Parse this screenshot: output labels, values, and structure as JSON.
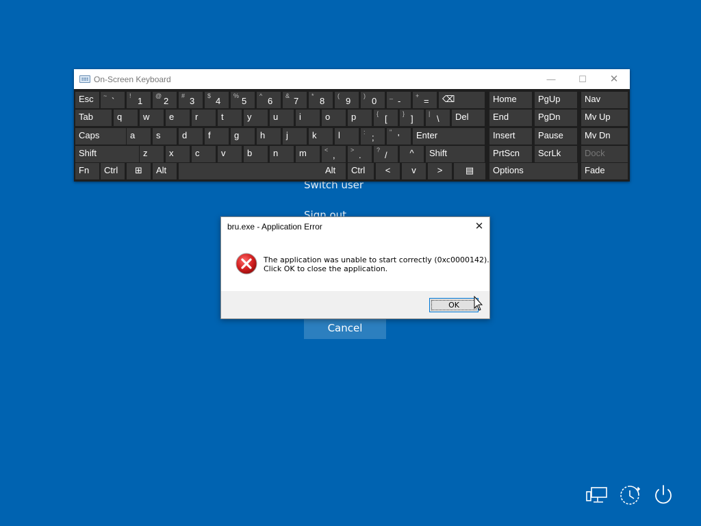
{
  "background": {
    "color": "#0063b1",
    "switch_user": "Switch user",
    "sign_out": "Sign out",
    "cancel": "Cancel"
  },
  "osk": {
    "title": "On-Screen Keyboard",
    "minimize": "—",
    "maximize": "☐",
    "close": "✕",
    "rows": [
      [
        {
          "label": "Esc"
        },
        {
          "shift": "~",
          "main": "`"
        },
        {
          "shift": "!",
          "main": "1"
        },
        {
          "shift": "@",
          "main": "2"
        },
        {
          "shift": "#",
          "main": "3"
        },
        {
          "shift": "$",
          "main": "4"
        },
        {
          "shift": "%",
          "main": "5"
        },
        {
          "shift": "^",
          "main": "6"
        },
        {
          "shift": "&",
          "main": "7"
        },
        {
          "shift": "*",
          "main": "8"
        },
        {
          "shift": "(",
          "main": "9"
        },
        {
          "shift": ")",
          "main": "0"
        },
        {
          "shift": "_",
          "main": "-"
        },
        {
          "shift": "+",
          "main": "="
        },
        {
          "label": "⌫",
          "icon": "backspace-icon"
        },
        {
          "label": "Home"
        },
        {
          "label": "PgUp"
        },
        {
          "label": "Nav"
        }
      ],
      [
        {
          "label": "Tab"
        },
        {
          "label": "q"
        },
        {
          "label": "w"
        },
        {
          "label": "e"
        },
        {
          "label": "r"
        },
        {
          "label": "t"
        },
        {
          "label": "y"
        },
        {
          "label": "u"
        },
        {
          "label": "i"
        },
        {
          "label": "o"
        },
        {
          "label": "p"
        },
        {
          "shift": "{",
          "main": "["
        },
        {
          "shift": "}",
          "main": "]"
        },
        {
          "shift": "|",
          "main": "\\"
        },
        {
          "label": "Del"
        },
        {
          "label": "End"
        },
        {
          "label": "PgDn"
        },
        {
          "label": "Mv Up"
        }
      ],
      [
        {
          "label": "Caps"
        },
        {
          "label": "a"
        },
        {
          "label": "s"
        },
        {
          "label": "d"
        },
        {
          "label": "f"
        },
        {
          "label": "g"
        },
        {
          "label": "h"
        },
        {
          "label": "j"
        },
        {
          "label": "k"
        },
        {
          "label": "l"
        },
        {
          "shift": ":",
          "main": ";"
        },
        {
          "shift": "\"",
          "main": "'"
        },
        {
          "label": "Enter"
        },
        {
          "label": "Insert"
        },
        {
          "label": "Pause"
        },
        {
          "label": "Mv Dn"
        }
      ],
      [
        {
          "label": "Shift"
        },
        {
          "label": "z"
        },
        {
          "label": "x"
        },
        {
          "label": "c"
        },
        {
          "label": "v"
        },
        {
          "label": "b"
        },
        {
          "label": "n"
        },
        {
          "label": "m"
        },
        {
          "shift": "<",
          "main": ","
        },
        {
          "shift": ">",
          "main": "."
        },
        {
          "shift": "?",
          "main": "/"
        },
        {
          "label": "^",
          "icon": "arrow-up-icon"
        },
        {
          "label": "Shift"
        },
        {
          "label": "PrtScn"
        },
        {
          "label": "ScrLk"
        },
        {
          "label": "Dock",
          "disabled": true
        }
      ],
      [
        {
          "label": "Fn"
        },
        {
          "label": "Ctrl"
        },
        {
          "label": "⊞",
          "icon": "windows-icon"
        },
        {
          "label": "Alt"
        },
        {
          "label": ""
        },
        {
          "label": "Alt"
        },
        {
          "label": "Ctrl"
        },
        {
          "label": "<",
          "icon": "arrow-left-icon"
        },
        {
          "label": "v",
          "icon": "arrow-down-icon"
        },
        {
          "label": ">",
          "icon": "arrow-right-icon"
        },
        {
          "label": "▤",
          "icon": "menu-key-icon"
        },
        {
          "label": "Options"
        },
        {
          "label": "Fade"
        }
      ]
    ]
  },
  "dialog": {
    "title": "bru.exe - Application Error",
    "close": "✕",
    "message_line1": "The application was unable to start correctly (0xc0000142).",
    "message_line2": "Click OK to close the application.",
    "ok": "OK",
    "icon": "error-icon"
  },
  "system_icons": [
    "network-icon",
    "ease-of-access-icon",
    "power-icon"
  ]
}
